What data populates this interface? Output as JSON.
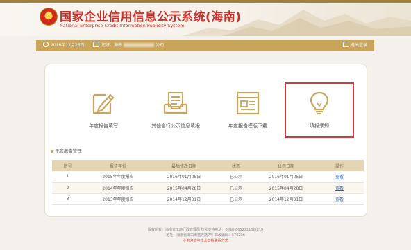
{
  "header": {
    "title": "国家企业信用信息公示系统(海南)",
    "subtitle": "National Enterprise Credit Information Publicity System"
  },
  "infobar": {
    "date": "2016年12月25日",
    "welcome_prefix": "您好：",
    "welcome_company_start": "海南",
    "welcome_company_end": "公司",
    "logout_label": "退出登录"
  },
  "tiles": [
    {
      "label": "年度报告填写",
      "icon": "edit-document-icon"
    },
    {
      "label": "其他自行公示信息填报",
      "icon": "inbox-tray-icon"
    },
    {
      "label": "年度报告模版下载",
      "icon": "template-document-icon"
    },
    {
      "label": "填报须知",
      "icon": "lightbulb-icon"
    }
  ],
  "section": {
    "title": "年度报告管理"
  },
  "table": {
    "headers": [
      "序号",
      "报告年份",
      "最后修改日期",
      "状态",
      "公示日期",
      "操作"
    ],
    "rows": [
      [
        "1",
        "2015年年度报告",
        "2016年01月05日",
        "已公示",
        "2016年01月05日",
        "查看"
      ],
      [
        "2",
        "2014年年度报告",
        "2015年04月28日",
        "已公示",
        "2015年04月28日",
        "查看"
      ],
      [
        "3",
        "2013年年度报告",
        "2014年12月31日",
        "已公示",
        "2014年12月31日",
        "查看"
      ]
    ]
  },
  "footer": {
    "line1": "版权所有：海南省工商行政管理局  技术支持电话：0898-66521115转819",
    "line2": "地址：海南省海口市蓝天路7号  邮政编码：570206",
    "line3": "业务咨询与技术支持联系方式"
  },
  "colors": {
    "accent_gold": "#c9a55c",
    "title_red": "#c4302b",
    "highlight_border": "#d53a3a",
    "link_blue": "#2f5fb3"
  }
}
